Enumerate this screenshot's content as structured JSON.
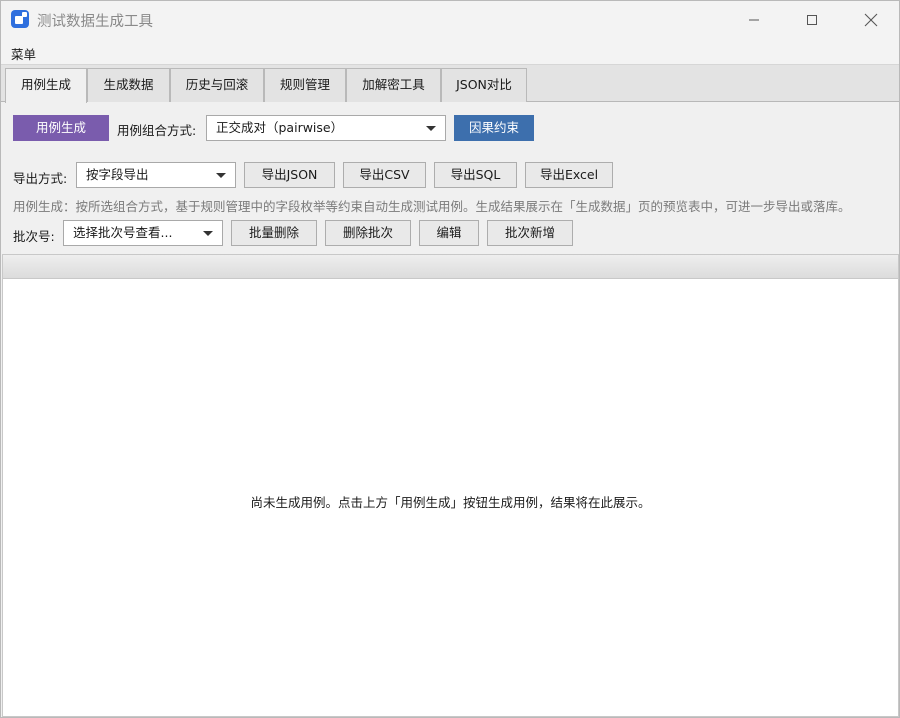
{
  "window": {
    "title": "测试数据生成工具",
    "icon": "app-icon",
    "controls": [
      "minimize-icon",
      "maximize-icon",
      "close-icon"
    ]
  },
  "menu": {
    "label": "菜单"
  },
  "tabs": [
    {
      "label": "用例生成",
      "active": true
    },
    {
      "label": "生成数据",
      "active": false
    },
    {
      "label": "历史与回滚",
      "active": false
    },
    {
      "label": "规则管理",
      "active": false
    },
    {
      "label": "加解密工具",
      "active": false
    },
    {
      "label": "JSON对比",
      "active": false
    }
  ],
  "toolbar": {
    "generate_label": "用例生成",
    "combo_label": "用例组合方式:",
    "combo_value": "正交成对（pairwise）",
    "constraint_label": "因果约束"
  },
  "export": {
    "label": "导出方式:",
    "mode_value": "按字段导出",
    "json_label": "导出JSON",
    "csv_label": "导出CSV",
    "sql_label": "导出SQL",
    "excel_label": "导出Excel"
  },
  "hint": "用例生成：按所选组合方式，基于规则管理中的字段枚举等约束自动生成测试用例。生成结果展示在「生成数据」页的预览表中，可进一步导出或落库。",
  "batch": {
    "label": "批次号:",
    "placeholder": "选择批次号查看...",
    "bulk_delete_label": "批量删除",
    "delete_batch_label": "删除批次",
    "edit_label": "编辑",
    "add_batch_label": "批次新增"
  },
  "table": {
    "empty_message": "尚未生成用例。点击上方「用例生成」按钮生成用例，结果将在此展示。"
  },
  "colors": {
    "primary_button": "#7a5cad",
    "accent_button": "#3d6fad",
    "window_bg": "#f0f0f0"
  }
}
